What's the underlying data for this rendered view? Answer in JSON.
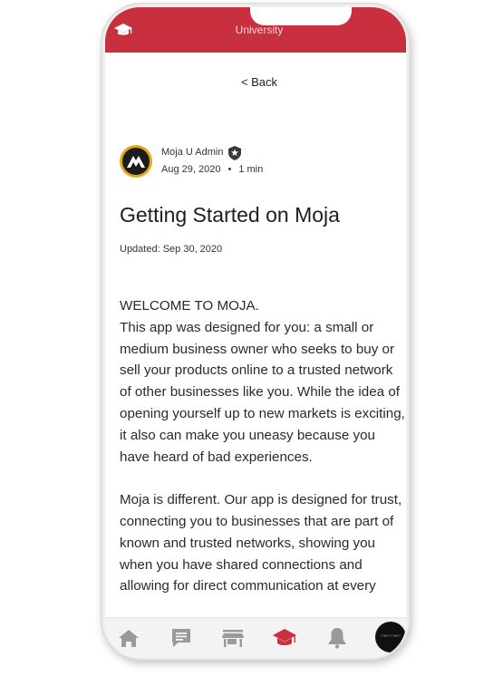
{
  "header": {
    "title": "University"
  },
  "navigation": {
    "back_label": "< Back"
  },
  "post": {
    "author": "Moja U Admin",
    "date": "Aug 29, 2020",
    "separator": "•",
    "read_time": "1 min",
    "title": "Getting Started on Moja",
    "updated": "Updated: Sep 30, 2020",
    "paragraph1_heading": "WELCOME TO MOJA.",
    "paragraph1": "This app was designed for you: a small or medium business owner who seeks to buy or sell your products online to a trusted network of other businesses like you. While the idea of opening yourself up to new markets is exciting, it also can make you uneasy because you have heard of bad experiences.",
    "paragraph2": "Moja is different. Our app is designed for trust, connecting you to businesses that are part of known and trusted networks, showing you when you have shared connections and allowing for direct communication at every"
  },
  "bottom_nav": {
    "items": [
      "home-icon",
      "chat-icon",
      "store-icon",
      "graduation-cap-icon",
      "bell-icon",
      "profile-avatar"
    ],
    "active": "graduation-cap-icon"
  },
  "colors": {
    "brand_red": "#c8303f",
    "inactive_icon": "#9a9a9a",
    "avatar_ring": "#e6a817"
  }
}
